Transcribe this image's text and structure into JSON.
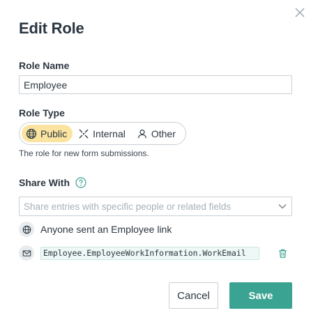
{
  "dialog": {
    "title": "Edit Role"
  },
  "role_name": {
    "label": "Role Name",
    "value": "Employee"
  },
  "role_type": {
    "label": "Role Type",
    "options": [
      {
        "label": "Public",
        "icon": "globe-icon",
        "selected": true
      },
      {
        "label": "Internal",
        "icon": "internal-icon",
        "selected": false
      },
      {
        "label": "Other",
        "icon": "user-icon",
        "selected": false
      }
    ],
    "hint": "The role for new form submissions."
  },
  "share_with": {
    "label": "Share With",
    "placeholder": "Share entries with specific people or related fields",
    "entries": [
      {
        "icon": "globe-icon",
        "text": "Anyone sent an Employee link"
      },
      {
        "icon": "mail-icon",
        "text": "Employee.EmployeeWorkInformation.WorkEmail"
      }
    ]
  },
  "footer": {
    "cancel_label": "Cancel",
    "save_label": "Save"
  },
  "colors": {
    "accent": "#3aa392",
    "selected_option_bg": "#fbe4a0",
    "help_icon": "#3aa392"
  }
}
